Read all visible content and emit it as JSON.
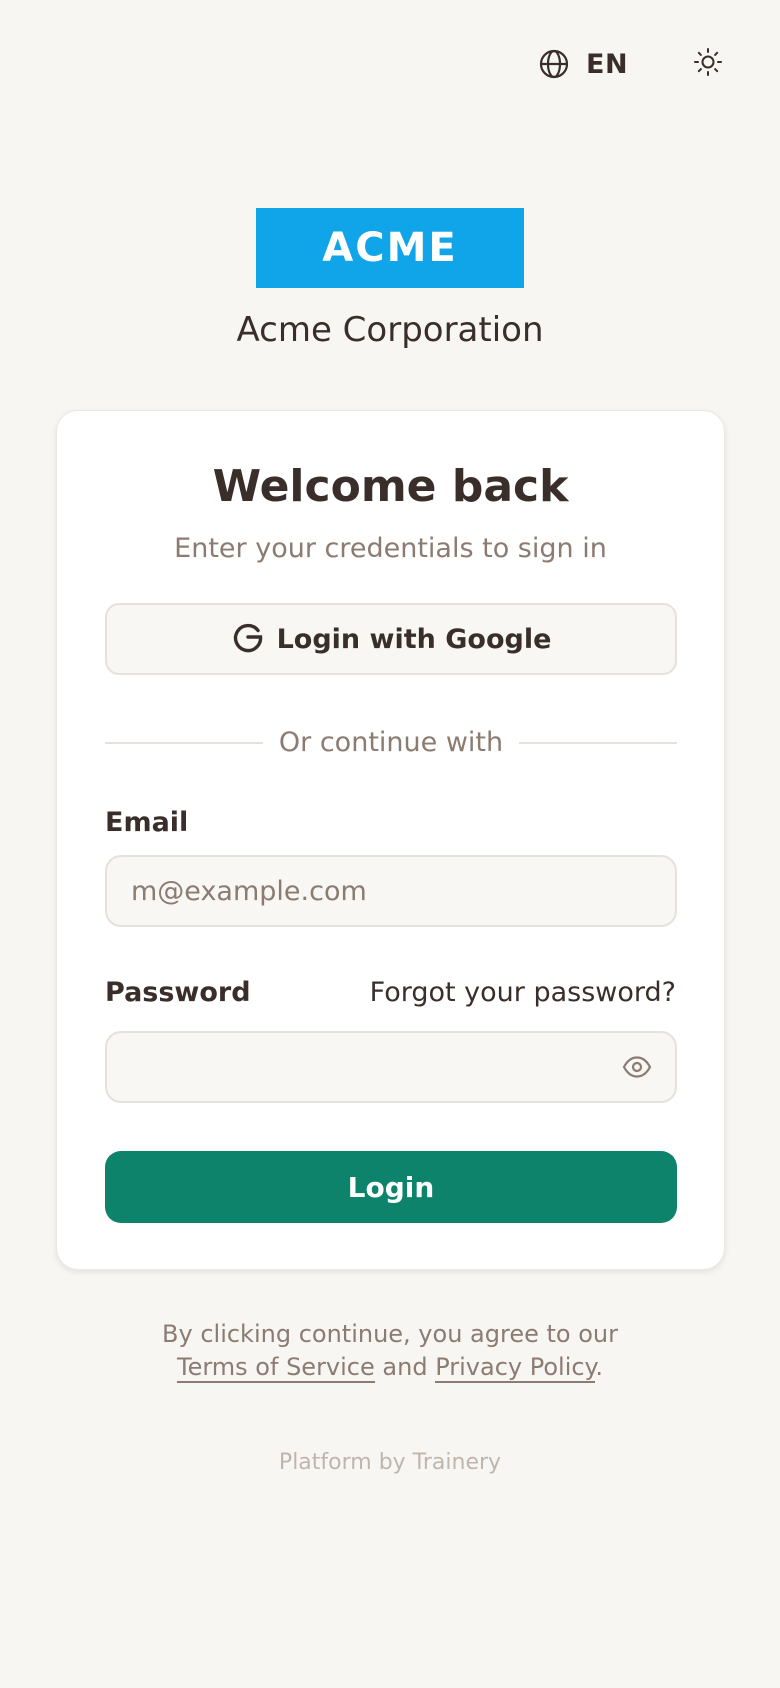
{
  "top_bar": {
    "language_code": "EN",
    "globe_icon": "globe-icon",
    "theme_icon": "sun-icon"
  },
  "brand": {
    "logo_text": "ACME",
    "logo_color": "#10a5e8",
    "org_name": "Acme Corporation"
  },
  "card": {
    "title": "Welcome back",
    "subtitle": "Enter your credentials to sign in",
    "google_button_label": "Login with Google",
    "google_icon": "google-g-icon",
    "divider_text": "Or continue with",
    "email_label": "Email",
    "email_placeholder": "m@example.com",
    "email_value": "",
    "password_label": "Password",
    "forgot_password": "Forgot your password?",
    "password_value": "",
    "eye_icon": "eye-icon",
    "login_button_label": "Login",
    "login_button_color": "#0e836b"
  },
  "legal": {
    "prefix": "By clicking continue, you agree to our",
    "terms": "Terms of Service",
    "and": "and",
    "privacy": "Privacy Policy",
    "suffix": "."
  },
  "footer": {
    "text": "Platform by Trainery"
  }
}
